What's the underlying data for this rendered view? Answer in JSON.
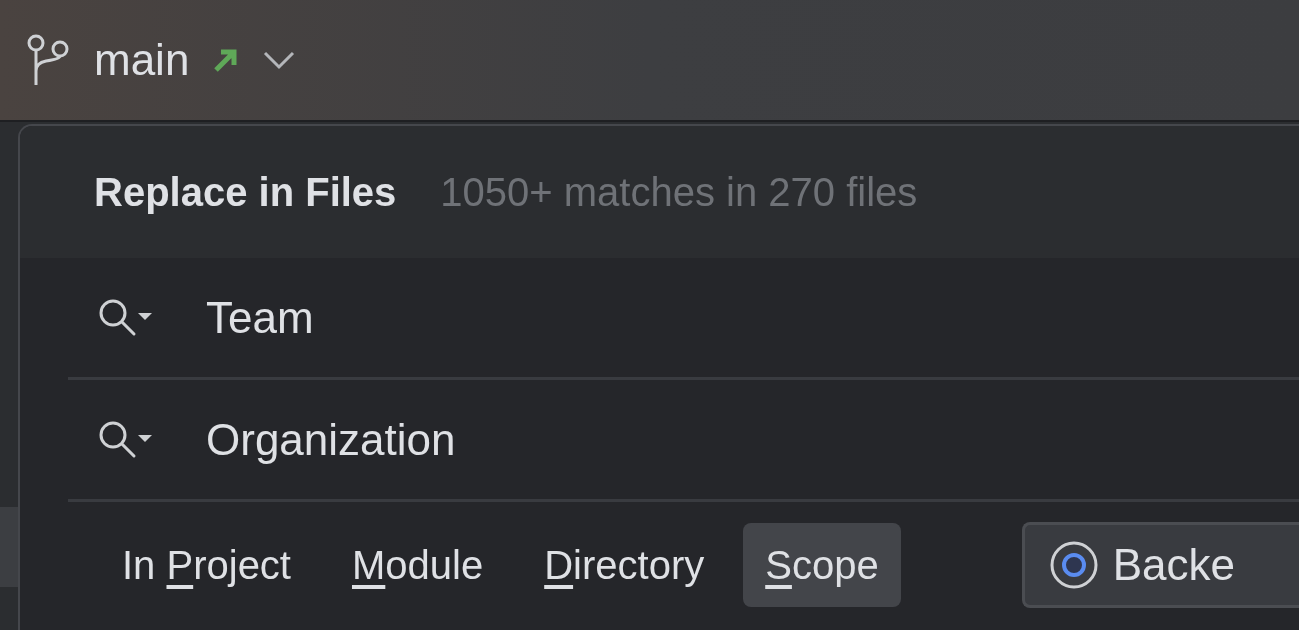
{
  "toolbar": {
    "branch": "main"
  },
  "dialog": {
    "title": "Replace in Files",
    "summary": "1050+ matches in 270 files",
    "search_field": {
      "value": "Team"
    },
    "replace_field": {
      "value": "Organization"
    },
    "scope_tabs": [
      {
        "before": "In ",
        "key": "P",
        "after": "roject",
        "selected": false
      },
      {
        "key": "M",
        "after": "odule",
        "selected": false
      },
      {
        "key": "D",
        "after": "irectory",
        "selected": false
      },
      {
        "key": "S",
        "after": "cope",
        "selected": true
      }
    ],
    "scope_dropdown": {
      "value": "Backe"
    }
  }
}
